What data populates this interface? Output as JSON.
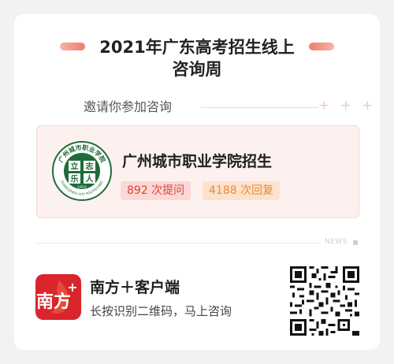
{
  "header": {
    "title_line1": "2021年广东高考招生线上",
    "title_line2": "咨询周"
  },
  "invite": {
    "label": "邀请你参加咨询",
    "decoration": "+ + +"
  },
  "school": {
    "name": "广州城市职业学院招生",
    "questions_badge": "892 次提问",
    "answers_badge": "4188 次回复",
    "logo": {
      "icon": "school-emblem-icon",
      "text_top": "广州城市职业学院",
      "text_bottom": "GUANGZHOU CITY POLYTECHNIC",
      "year": "1952",
      "center_chars": [
        "立",
        "志",
        "乐",
        "业",
        "人"
      ],
      "color": "#1f6b3a"
    }
  },
  "divider": {
    "label": "NEWS"
  },
  "app": {
    "icon": "nanfang-plus-logo-icon",
    "icon_text": "南方",
    "icon_plus": "+",
    "icon_color": "#d9252b",
    "name": "南方＋客户端",
    "hint": "长按识别二维码，马上咨询"
  },
  "qr": {
    "icon": "qr-code-icon"
  },
  "colors": {
    "accent_red": "#d8473d",
    "accent_orange": "#e98a3b",
    "box_bg": "#fdf1ef"
  }
}
